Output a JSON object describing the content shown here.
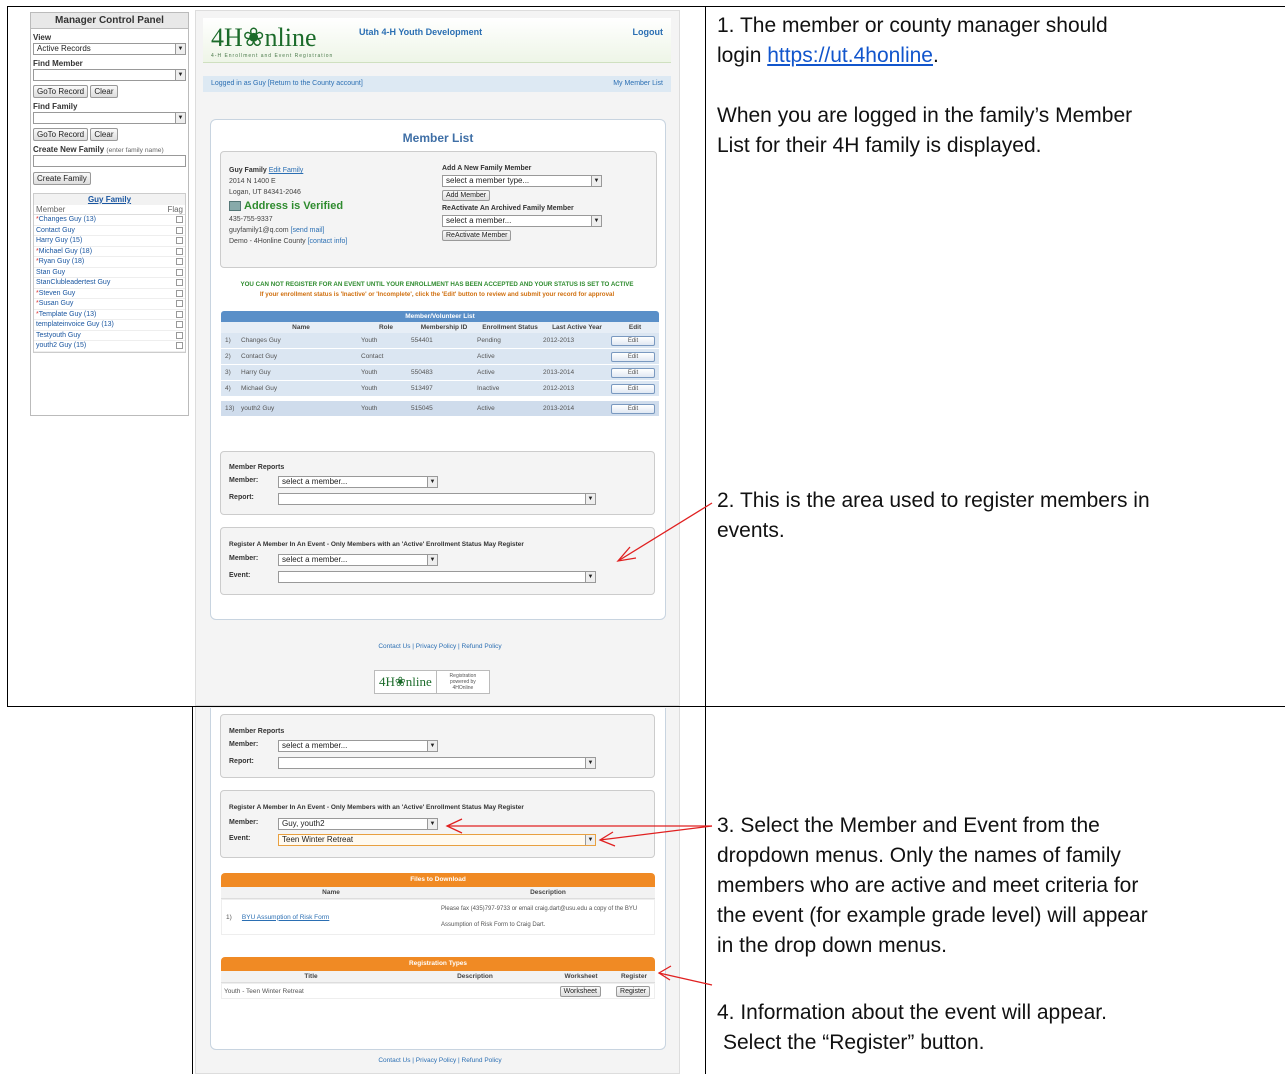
{
  "steps": {
    "s1a": "1.  The member or county manager should",
    "s1b_prefix": "login ",
    "s1_link": "https://ut.4honline",
    "s1b_suffix": ".",
    "s1c": "When you are logged in the family’s Member",
    "s1d": "List for their 4H family is displayed.",
    "s2a": "2. This is the area used to register members in",
    "s2b": "events.",
    "s3a": "3.  Select the Member and Event from the",
    "s3b": "dropdown menus. Only the names of family",
    "s3c": "members who are active and meet criteria for",
    "s3d": "the event (for example grade level) will appear",
    "s3e": "in the drop down menus.",
    "s4a": "4.  Information about the event will appear.",
    "s4b": "Select the “Register” button."
  },
  "manager": {
    "title": "Manager Control Panel",
    "view_label": "View",
    "view_value": "Active Records",
    "find_member_label": "Find Member",
    "goto_label": "GoTo Record",
    "clear_label": "Clear",
    "find_family_label": "Find Family",
    "create_family_label": "Create New Family",
    "create_family_hint": "(enter family name)",
    "create_family_button": "Create Family",
    "family_title": "Guy Family",
    "col_member": "Member",
    "col_flag": "Flag",
    "members": [
      {
        "star": "*",
        "name": "Changes Guy (13)"
      },
      {
        "star": "",
        "name": "Contact Guy"
      },
      {
        "star": "",
        "name": "Harry Guy (15)"
      },
      {
        "star": "*",
        "name": "Michael Guy (18)"
      },
      {
        "star": "*",
        "name": "Ryan Guy (18)"
      },
      {
        "star": "",
        "name": "Stan Guy"
      },
      {
        "star": "",
        "name": "StanClubleadertest Guy"
      },
      {
        "star": "*",
        "name": "Steven Guy"
      },
      {
        "star": "*",
        "name": "Susan Guy"
      },
      {
        "star": "*",
        "name": "Template Guy (13)"
      },
      {
        "star": "",
        "name": "templateinvoice Guy (13)"
      },
      {
        "star": "",
        "name": "Testyouth Guy"
      },
      {
        "star": "",
        "name": "youth2 Guy (15)"
      }
    ]
  },
  "site": {
    "logo": "4H❀nline",
    "logo_tag": "4-H Enrollment and Event Registration",
    "org": "Utah 4-H Youth Development",
    "logout": "Logout",
    "logged_in": "Logged in as Guy [Return to the County account]",
    "my_member_list": "My Member List",
    "member_list_title": "Member List",
    "family_name": "Guy Family",
    "edit_family": "Edit Family",
    "addr1": "2014 N 1400 E",
    "addr2": "Logan, UT 84341-2046",
    "verified": "Address is Verified",
    "phone": "435-755-9337",
    "email": "guyfamily1@q.com",
    "send_mail": "[send mail]",
    "county": "Demo - 4Honline County",
    "contact_info": "[contact info]",
    "add_new_label": "Add A New Family Member",
    "add_new_select": "select a member type...",
    "add_member_button": "Add Member",
    "reactivate_label": "ReActivate An Archived Family Member",
    "reactivate_select": "select a member...",
    "reactivate_button": "ReActivate Member",
    "warn1": "YOU CAN NOT REGISTER FOR AN EVENT UNTIL YOUR ENROLLMENT HAS BEEN ACCEPTED AND YOUR STATUS IS SET TO ACTIVE",
    "warn2": "If your enrollment status is 'Inactive' or 'Incomplete', click the 'Edit' button to review and submit your record for approval",
    "table_title": "Member/Volunteer List",
    "cols": [
      "",
      "Name",
      "Role",
      "Membership ID",
      "Enrollment Status",
      "Last Active Year",
      "Edit"
    ],
    "rows": [
      {
        "n": "1)",
        "name": "Changes Guy",
        "role": "Youth",
        "id": "554401",
        "status": "Pending",
        "year": "2012-2013"
      },
      {
        "n": "2)",
        "name": "Contact Guy",
        "role": "Contact",
        "id": "",
        "status": "Active",
        "year": ""
      },
      {
        "n": "3)",
        "name": "Harry Guy",
        "role": "Youth",
        "id": "550483",
        "status": "Active",
        "year": "2013-2014"
      },
      {
        "n": "4)",
        "name": "Michael Guy",
        "role": "Youth",
        "id": "513497",
        "status": "Inactive",
        "year": "2012-2013"
      },
      {
        "n": "13)",
        "name": "youth2 Guy",
        "role": "Youth",
        "id": "515045",
        "status": "Active",
        "year": "2013-2014"
      }
    ],
    "edit_label": "Edit",
    "reports_title": "Member Reports",
    "member_label": "Member:",
    "report_label": "Report:",
    "select_member": "select a member...",
    "register_title": "Register A Member In An Event - Only Members with an 'Active' Enrollment Status May Register",
    "event_label": "Event:",
    "footer_links": "Contact Us  |  Privacy Policy  |  Refund Policy",
    "footer_logo": "4H❀nline",
    "footer_powered": "Registration powered by 4HOnline",
    "selected_member": "Guy, youth2",
    "selected_event": "Teen Winter Retreat",
    "files_title": "Files to Download",
    "files_cols": [
      "Name",
      "Description"
    ],
    "file_n": "1)",
    "file_name": "BYU Assumption of Risk Form",
    "file_desc": "Please fax (435)797-9733 or email craig.dart@usu.edu a copy of the BYU Assumption of Risk Form to Craig Dart.",
    "reg_title": "Registration Types",
    "reg_cols": [
      "Title",
      "Description",
      "Worksheet",
      "Register"
    ],
    "reg_row_title": "Youth - Teen Winter Retreat",
    "worksheet_button": "Worksheet",
    "register_button": "Register"
  }
}
